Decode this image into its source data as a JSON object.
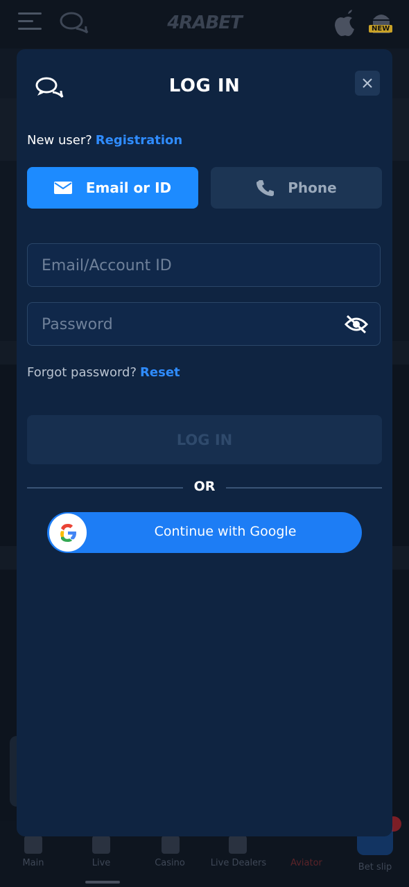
{
  "background": {
    "brand": "4RABET",
    "new_badge": "NEW",
    "nav": [
      {
        "label": "Main"
      },
      {
        "label": "Live"
      },
      {
        "label": "Casino"
      },
      {
        "label": "Live Dealers"
      },
      {
        "label": "Aviator"
      },
      {
        "label": "Bet slip"
      }
    ]
  },
  "modal": {
    "title": "LOG IN",
    "new_user_text": "New user?",
    "registration_link": "Registration",
    "tabs": [
      {
        "label": "Email or ID",
        "icon": "envelope-icon",
        "active": true
      },
      {
        "label": "Phone",
        "icon": "phone-icon",
        "active": false
      }
    ],
    "email_placeholder": "Email/Account ID",
    "password_placeholder": "Password",
    "forgot_text": "Forgot password?",
    "reset_link": "Reset",
    "login_button": "LOG IN",
    "or_text": "OR",
    "google_button": "Continue with Google"
  },
  "colors": {
    "accent": "#1d8bff",
    "link": "#2f8cff",
    "modal_bg": "#0f2441",
    "google_button": "#1d7df5"
  }
}
